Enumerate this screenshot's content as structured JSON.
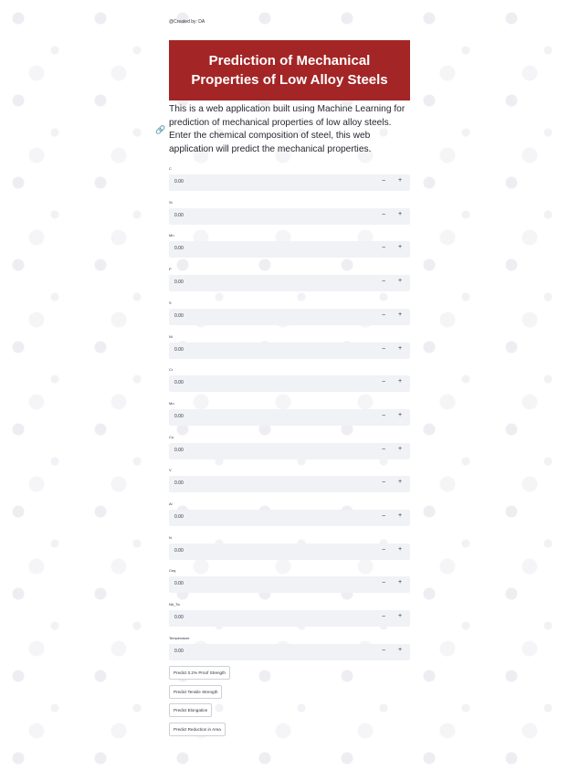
{
  "credit": "@Created by: DA",
  "title_line1": "Prediction of Mechanical",
  "title_line2": "Properties of Low Alloy Steels",
  "description": "This is a web application built using Machine Learning for prediction of mechanical properties of low alloy steels. Enter the chemical composition of steel, this web application will predict the mechanical properties.",
  "link_icon": "link-icon",
  "stepper_minus": "−",
  "stepper_plus": "+",
  "fields": [
    {
      "label": "C",
      "value": "0.00"
    },
    {
      "label": "Si",
      "value": "0.00"
    },
    {
      "label": "Mn",
      "value": "0.00"
    },
    {
      "label": "P",
      "value": "0.00"
    },
    {
      "label": "S",
      "value": "0.00"
    },
    {
      "label": "Ni",
      "value": "0.00"
    },
    {
      "label": "Cr",
      "value": "0.00"
    },
    {
      "label": "Mo",
      "value": "0.00"
    },
    {
      "label": "Cu",
      "value": "0.00"
    },
    {
      "label": "V",
      "value": "0.00"
    },
    {
      "label": "Al",
      "value": "0.00"
    },
    {
      "label": "N",
      "value": "0.00"
    },
    {
      "label": "Ceq",
      "value": "0.00"
    },
    {
      "label": "Nb_Ta",
      "value": "0.00"
    },
    {
      "label": "Temperature",
      "value": "0.00"
    }
  ],
  "buttons": [
    "Predict 0.2% Proof Strength",
    "Predict Tensile Strength",
    "Predict Elongation",
    "Predict Reduction in Area"
  ],
  "colors": {
    "title_bg": "#a42526",
    "input_bg": "#f0f2f6"
  }
}
